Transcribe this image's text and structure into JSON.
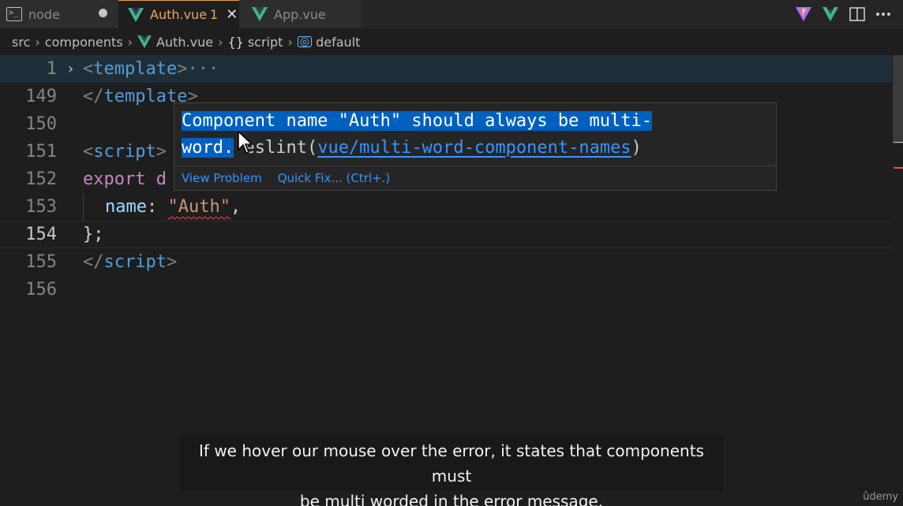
{
  "tabs": [
    {
      "label": "node",
      "icon": "terminal-icon",
      "dirty": true
    },
    {
      "label": "Auth.vue",
      "errors": "1",
      "icon": "vue-icon",
      "active": true
    },
    {
      "label": "App.vue",
      "icon": "vue-icon"
    }
  ],
  "close_glyph": "✕",
  "dirty_glyph": "●",
  "breadcrumb": {
    "items": [
      "src",
      "components",
      "Auth.vue",
      "script",
      "default"
    ],
    "separator": "›",
    "braces": "{}"
  },
  "editor": {
    "lines": [
      {
        "number": "1",
        "fold": "›",
        "tokens": {
          "open": "<",
          "name": "template",
          "close": ">",
          "ellipsis": "···"
        }
      },
      {
        "number": "149",
        "tokens": {
          "open": "</",
          "name": "template",
          "close": ">"
        }
      },
      {
        "number": "150"
      },
      {
        "number": "151",
        "tokens": {
          "open": "<",
          "name": "script",
          "close": ">"
        }
      },
      {
        "number": "152",
        "tokens": {
          "kw": "export",
          "rest": " d"
        }
      },
      {
        "number": "153",
        "tokens": {
          "prop": "name",
          "colon": ": ",
          "str": "\"Auth\"",
          "comma": ","
        }
      },
      {
        "number": "154",
        "tokens": {
          "punc": "};"
        }
      },
      {
        "number": "155",
        "tokens": {
          "open": "</",
          "name": "script",
          "close": ">"
        }
      },
      {
        "number": "156"
      }
    ]
  },
  "hover": {
    "message_part1": "Component name \"Auth\" should always be multi-",
    "message_part2": "word.",
    "source": " eslint(",
    "rule": "vue/multi-word-component-names",
    "source_close": ")",
    "actions": [
      "View Problem",
      "Quick Fix... (Ctrl+.)"
    ]
  },
  "subtitle": {
    "line1": "If we hover our mouse over the error, it states that components must",
    "line2": "be multi worded in the error message."
  },
  "watermark": "ûdemy",
  "colors": {
    "accent": "#e6a23c",
    "error": "#f14c4c",
    "link": "#3794ff",
    "selection": "#0060c0",
    "vue_green": "#41b883",
    "vue_dark": "#35495e"
  },
  "toolbar_icons": [
    "vite-icon",
    "vue-devtools-icon",
    "split-editor-icon",
    "more-actions-icon"
  ]
}
